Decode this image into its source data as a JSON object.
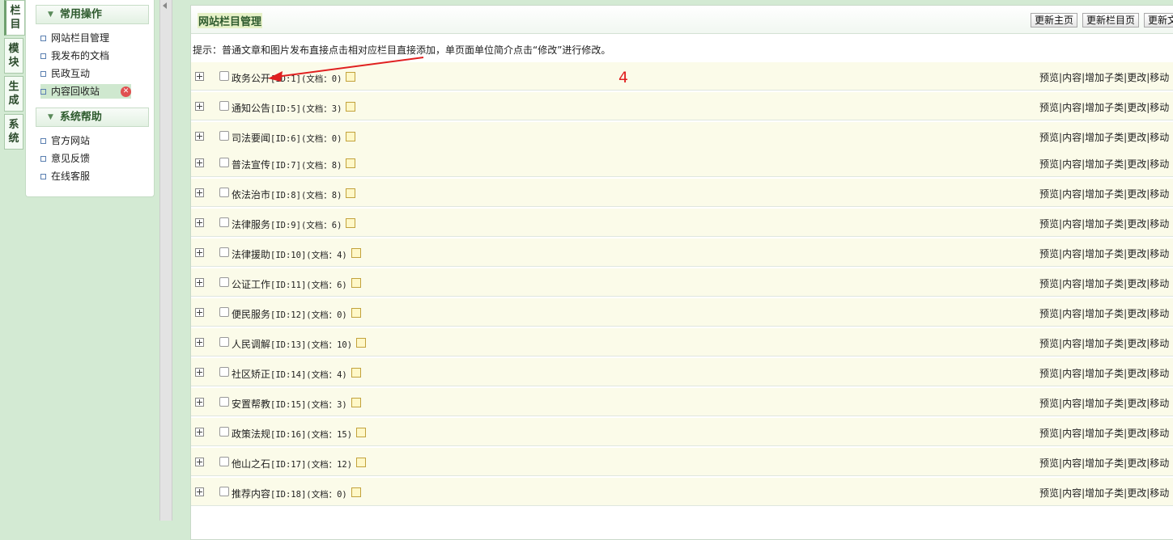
{
  "vtabs": [
    {
      "chars": [
        "栏",
        "目"
      ]
    },
    {
      "chars": [
        "模",
        "块"
      ]
    },
    {
      "chars": [
        "生",
        "成"
      ]
    },
    {
      "chars": [
        "系",
        "统"
      ]
    }
  ],
  "sidebar": {
    "section1": "常用操作",
    "items1": [
      "网站栏目管理",
      "我发布的文档",
      "民政互动",
      "内容回收站"
    ],
    "section2": "系统帮助",
    "items2": [
      "官方网站",
      "意见反馈",
      "在线客服"
    ]
  },
  "main": {
    "title": "网站栏目管理",
    "buttons": [
      "更新主页",
      "更新栏目页",
      "更新文"
    ],
    "tip": "提示：普通文章和图片发布直接点击相对应栏目直接添加，单页面单位简介点击“修改”进行修改。",
    "ops": [
      "预览",
      "内容",
      "增加子类",
      "更改",
      "移动"
    ],
    "rows": [
      {
        "name": "政务公开",
        "id": "[ID:1]",
        "docs": "(文档：0)"
      },
      {
        "name": "通知公告",
        "id": "[ID:5]",
        "docs": "(文档：3)"
      },
      {
        "name": "司法要闻",
        "id": "[ID:6]",
        "docs": "(文档：0)"
      },
      {
        "name": "普法宣传",
        "id": "[ID:7]",
        "docs": "(文档：8)"
      },
      {
        "name": "依法治市",
        "id": "[ID:8]",
        "docs": "(文档：8)"
      },
      {
        "name": "法律服务",
        "id": "[ID:9]",
        "docs": "(文档：6)"
      },
      {
        "name": "法律援助",
        "id": "[ID:10]",
        "docs": "(文档：4)"
      },
      {
        "name": "公证工作",
        "id": "[ID:11]",
        "docs": "(文档：6)"
      },
      {
        "name": "便民服务",
        "id": "[ID:12]",
        "docs": "(文档：0)"
      },
      {
        "name": "人民调解",
        "id": "[ID:13]",
        "docs": "(文档：10)"
      },
      {
        "name": "社区矫正",
        "id": "[ID:14]",
        "docs": "(文档：4)"
      },
      {
        "name": "安置帮教",
        "id": "[ID:15]",
        "docs": "(文档：3)"
      },
      {
        "name": "政策法规",
        "id": "[ID:16]",
        "docs": "(文档：15)"
      },
      {
        "name": "他山之石",
        "id": "[ID:17]",
        "docs": "(文档：12)"
      },
      {
        "name": "推荐内容",
        "id": "[ID:18]",
        "docs": "(文档：0)"
      }
    ]
  },
  "annotation": "4",
  "colors": {
    "annotation": "#e02020",
    "row_bg": "#fbfbe9",
    "page_bg": "#d3ead3"
  }
}
